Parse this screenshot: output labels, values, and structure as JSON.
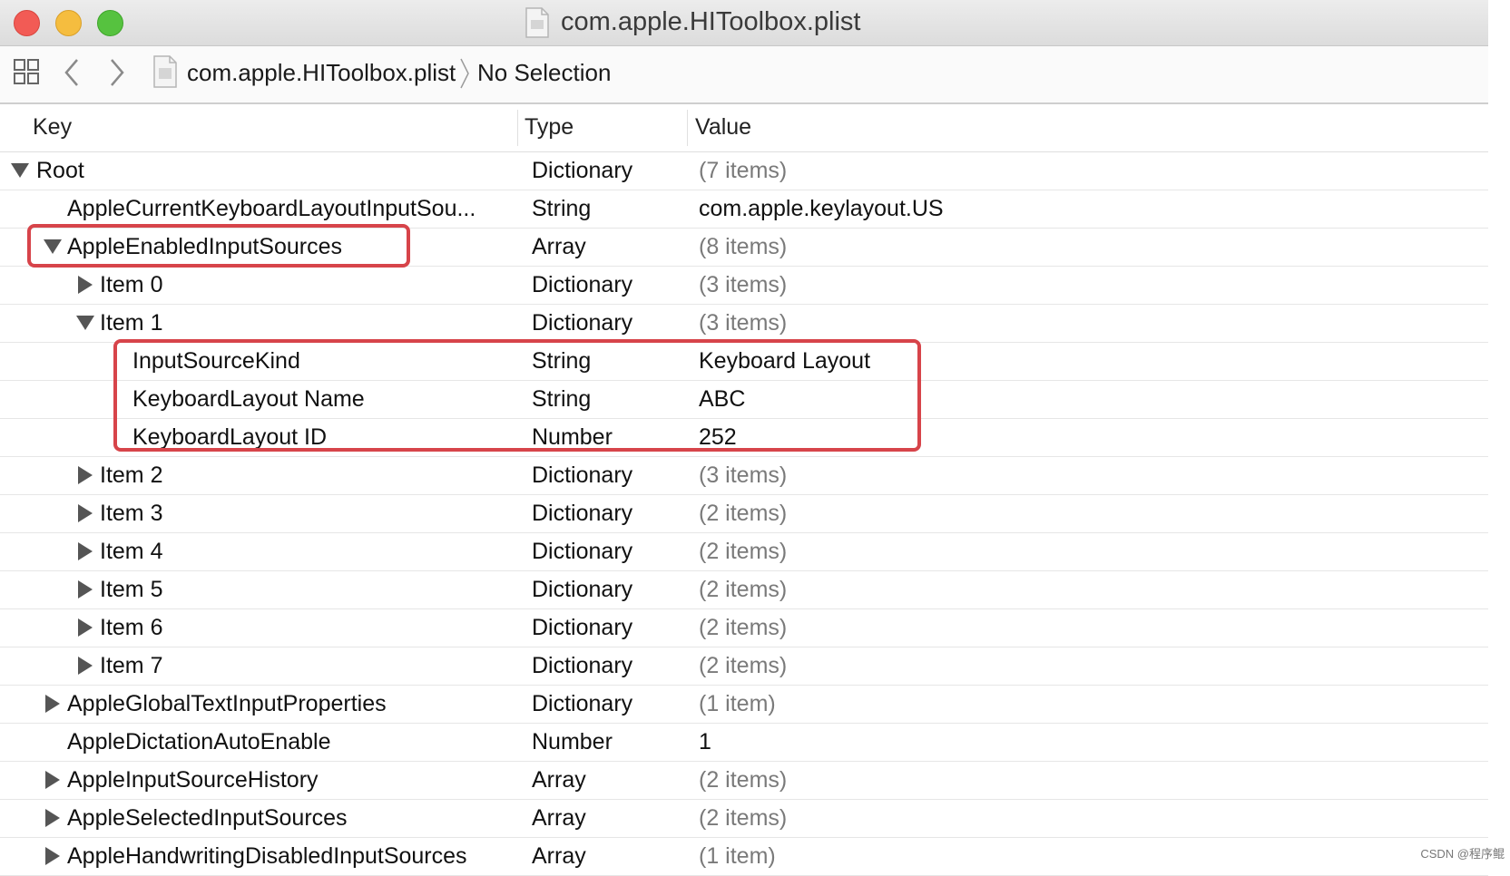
{
  "window": {
    "title": "com.apple.HIToolbox.plist",
    "traffic_lights": {
      "close": "#f25b55",
      "minimize": "#f5bd3f",
      "zoom": "#56c23f"
    }
  },
  "toolbar": {
    "grid_icon": "grid-icon",
    "back_icon": "chevron-left-icon",
    "forward_icon": "chevron-right-icon",
    "file_icon": "plist-file-icon",
    "breadcrumb_file": "com.apple.HIToolbox.plist",
    "breadcrumb_selection": "No Selection"
  },
  "columns": {
    "key": "Key",
    "type": "Type",
    "value": "Value"
  },
  "rows": [
    {
      "key": "Root",
      "type": "Dictionary",
      "value": "(7 items)",
      "depth": 0,
      "disclosure": "open",
      "value_gray": true
    },
    {
      "key": "AppleCurrentKeyboardLayoutInputSou...",
      "type": "String",
      "value": "com.apple.keylayout.US",
      "depth": 1,
      "disclosure": "none",
      "value_gray": false
    },
    {
      "key": "AppleEnabledInputSources",
      "type": "Array",
      "value": "(8 items)",
      "depth": 1,
      "disclosure": "open",
      "value_gray": true
    },
    {
      "key": "Item 0",
      "type": "Dictionary",
      "value": "(3 items)",
      "depth": 2,
      "disclosure": "closed",
      "value_gray": true
    },
    {
      "key": "Item 1",
      "type": "Dictionary",
      "value": "(3 items)",
      "depth": 2,
      "disclosure": "open",
      "value_gray": true
    },
    {
      "key": "InputSourceKind",
      "type": "String",
      "value": "Keyboard Layout",
      "depth": 3,
      "disclosure": "none",
      "value_gray": false
    },
    {
      "key": "KeyboardLayout Name",
      "type": "String",
      "value": "ABC",
      "depth": 3,
      "disclosure": "none",
      "value_gray": false
    },
    {
      "key": "KeyboardLayout ID",
      "type": "Number",
      "value": "252",
      "depth": 3,
      "disclosure": "none",
      "value_gray": false
    },
    {
      "key": "Item 2",
      "type": "Dictionary",
      "value": "(3 items)",
      "depth": 2,
      "disclosure": "closed",
      "value_gray": true
    },
    {
      "key": "Item 3",
      "type": "Dictionary",
      "value": "(2 items)",
      "depth": 2,
      "disclosure": "closed",
      "value_gray": true
    },
    {
      "key": "Item 4",
      "type": "Dictionary",
      "value": "(2 items)",
      "depth": 2,
      "disclosure": "closed",
      "value_gray": true
    },
    {
      "key": "Item 5",
      "type": "Dictionary",
      "value": "(2 items)",
      "depth": 2,
      "disclosure": "closed",
      "value_gray": true
    },
    {
      "key": "Item 6",
      "type": "Dictionary",
      "value": "(2 items)",
      "depth": 2,
      "disclosure": "closed",
      "value_gray": true
    },
    {
      "key": "Item 7",
      "type": "Dictionary",
      "value": "(2 items)",
      "depth": 2,
      "disclosure": "closed",
      "value_gray": true
    },
    {
      "key": "AppleGlobalTextInputProperties",
      "type": "Dictionary",
      "value": "(1 item)",
      "depth": 1,
      "disclosure": "closed",
      "value_gray": true
    },
    {
      "key": "AppleDictationAutoEnable",
      "type": "Number",
      "value": "1",
      "depth": 1,
      "disclosure": "none",
      "value_gray": false
    },
    {
      "key": "AppleInputSourceHistory",
      "type": "Array",
      "value": "(2 items)",
      "depth": 1,
      "disclosure": "closed",
      "value_gray": true
    },
    {
      "key": "AppleSelectedInputSources",
      "type": "Array",
      "value": "(2 items)",
      "depth": 1,
      "disclosure": "closed",
      "value_gray": true
    },
    {
      "key": "AppleHandwritingDisabledInputSources",
      "type": "Array",
      "value": "(1 item)",
      "depth": 1,
      "disclosure": "closed",
      "value_gray": true
    }
  ],
  "annotations": {
    "highlight_color": "#d7444a"
  },
  "watermark": "CSDN @程序鲲"
}
